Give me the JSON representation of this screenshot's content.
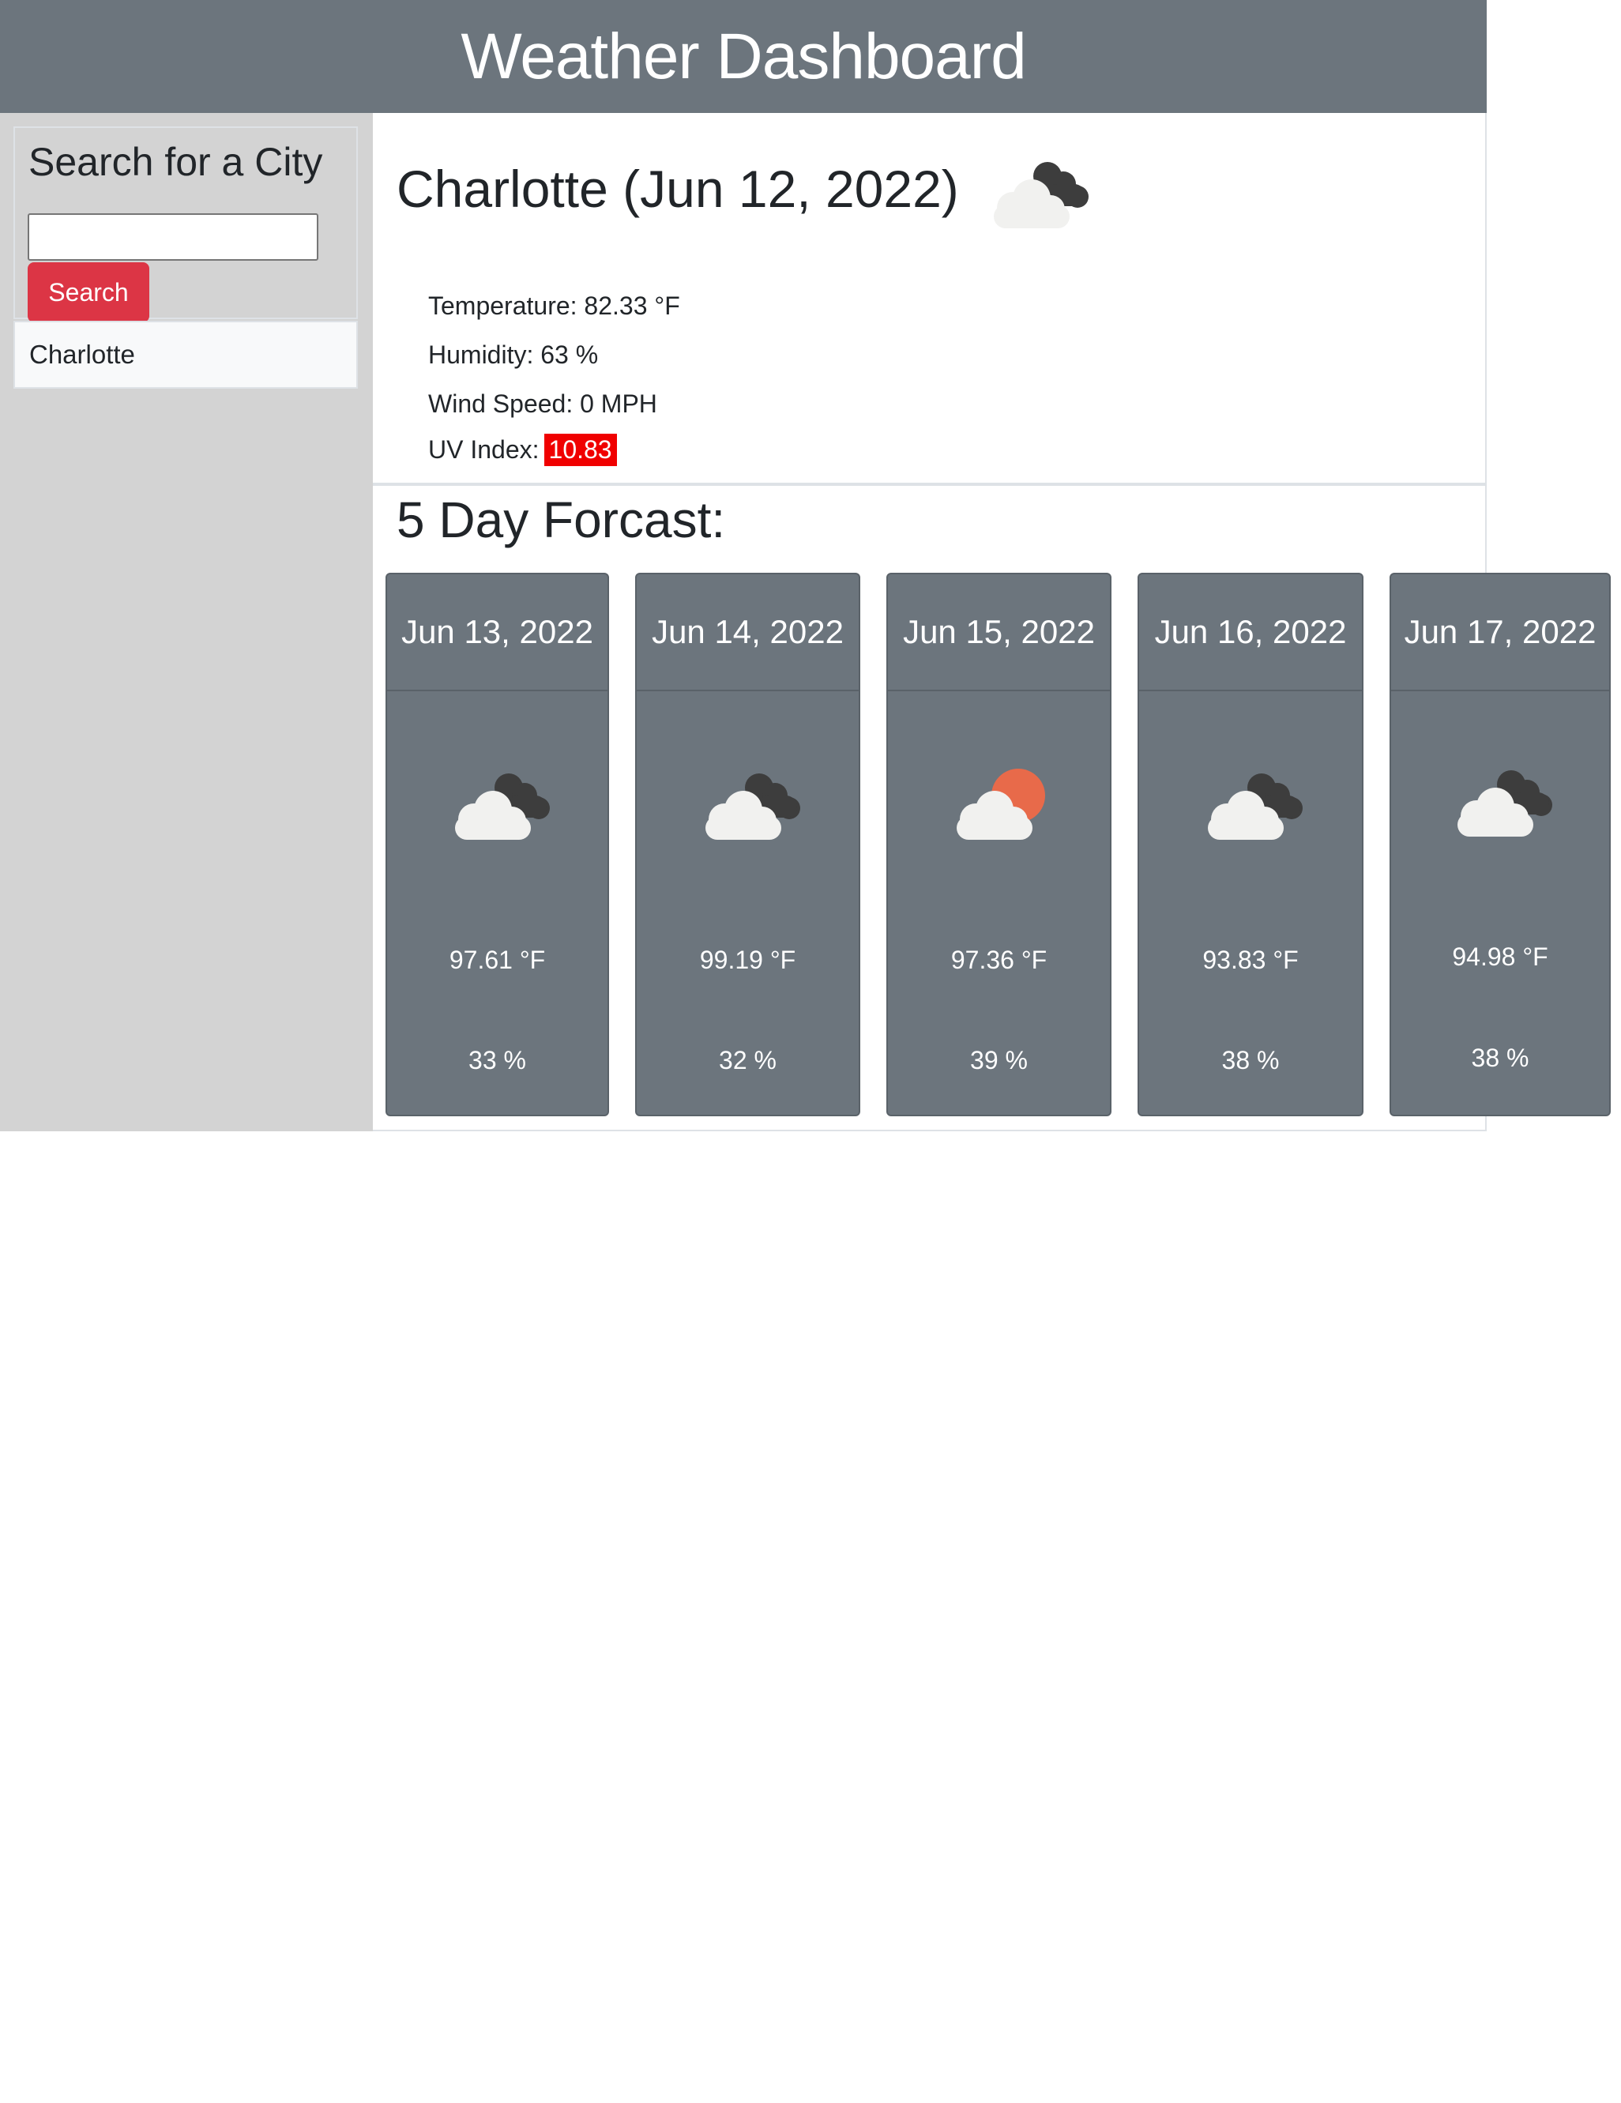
{
  "header": {
    "title": "Weather Dashboard"
  },
  "sidebar": {
    "search_title": "Search for a City",
    "search_input_value": "",
    "search_input_placeholder": "",
    "search_button_label": "Search",
    "history": [
      {
        "label": "Charlotte"
      }
    ]
  },
  "current": {
    "heading": "Charlotte (Jun 12, 2022)",
    "icon": "cloudy-icon",
    "temperature": "Temperature: 82.33 °F",
    "humidity": "Humidity: 63 %",
    "wind": "Wind Speed: 0 MPH",
    "uv_label": "UV Index:",
    "uv_value": "10.83",
    "uv_color": "#f00000"
  },
  "forecast": {
    "title": "5 Day Forcast:",
    "days": [
      {
        "date": "Jun 13, 2022",
        "icon": "cloudy-icon",
        "temp": "97.61 °F",
        "humidity": "33 %"
      },
      {
        "date": "Jun 14, 2022",
        "icon": "cloudy-icon",
        "temp": "99.19 °F",
        "humidity": "32 %"
      },
      {
        "date": "Jun 15, 2022",
        "icon": "partly-sunny-icon",
        "temp": "97.36 °F",
        "humidity": "39 %"
      },
      {
        "date": "Jun 16, 2022",
        "icon": "cloudy-icon",
        "temp": "93.83 °F",
        "humidity": "38 %"
      },
      {
        "date": "Jun 17, 2022",
        "icon": "cloudy-icon",
        "temp": "94.98 °F",
        "humidity": "38 %"
      }
    ]
  },
  "colors": {
    "header_bg": "#6c757d",
    "sidebar_bg": "#d3d3d3",
    "button_bg": "#dc3545",
    "card_bg": "#6c757d",
    "sun": "#e86a4a",
    "cloud_light": "#f1f1ef",
    "cloud_dark": "#3d3d3d"
  }
}
